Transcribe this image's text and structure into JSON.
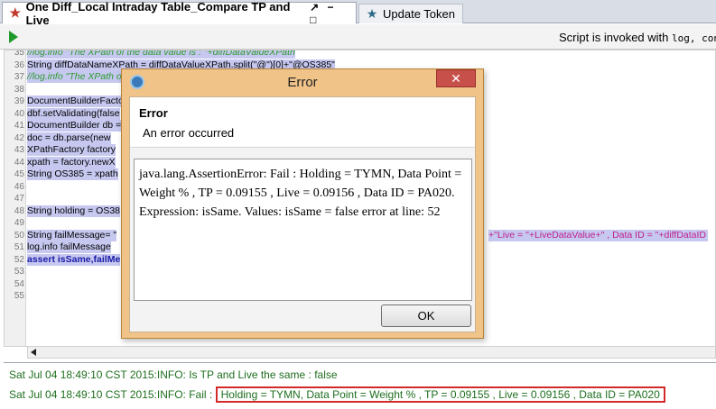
{
  "tabs": [
    {
      "label": "One Diff_Local Intraday Table_Compare TP and Live",
      "controls": "↗ − □"
    },
    {
      "label": "Update Token"
    }
  ],
  "toolbar": {
    "invoked_text": "Script is invoked with ",
    "invoked_code": "log, cont"
  },
  "code_lines": [
    {
      "num": "35",
      "text": "//log.info \"The XPath of the data value is : \"+diffDataValueXPath"
    },
    {
      "num": "36",
      "text": "String diffDataNameXPath = diffDataValueXPath.split(\"@\")[0]+\"@OS385\""
    },
    {
      "num": "37",
      "text": "//log.info \"The XPath o"
    },
    {
      "num": "38",
      "text": ""
    },
    {
      "num": "39",
      "text": "DocumentBuilderFacto"
    },
    {
      "num": "40",
      "text": "dbf.setValidating(false"
    },
    {
      "num": "41",
      "text": "DocumentBuilder db ="
    },
    {
      "num": "42",
      "text": "doc = db.parse(new"
    },
    {
      "num": "43",
      "text": "XPathFactory factory"
    },
    {
      "num": "44",
      "text": "xpath = factory.newX"
    },
    {
      "num": "45",
      "text": "String OS385 =  xpath"
    },
    {
      "num": "46",
      "text": ""
    },
    {
      "num": "47",
      "text": ""
    },
    {
      "num": "48",
      "text": "String holding = OS38"
    },
    {
      "num": "49",
      "text": ""
    },
    {
      "num": "50",
      "text": "String failMessage= \""
    },
    {
      "num": "51",
      "text": "log.info failMessage"
    },
    {
      "num": "52",
      "text": "assert isSame,failMe"
    },
    {
      "num": "53",
      "text": ""
    },
    {
      "num": "54",
      "text": ""
    },
    {
      "num": "55",
      "text": ""
    }
  ],
  "line50_tail": "+\"Live = \"+LiveDataValue+\" , Data ID = \"+diffDataID",
  "dialog": {
    "title": "Error",
    "close": "✕",
    "header": "Error",
    "subheader": "An error occurred",
    "message": "java.lang.AssertionError: Fail : Holding = TYMN, Data Point = Weight % , TP = 0.09155 , Live = 0.09156 , Data ID = PA020. Expression: isSame. Values: isSame = false error at line: 52",
    "ok": "OK"
  },
  "console": {
    "line1": "Sat Jul 04 18:49:10 CST 2015:INFO: Is TP and Live the same : false",
    "line2_prefix": "Sat Jul 04 18:49:10 CST 2015:INFO: Fail :",
    "line2_highlight": "Holding = TYMN, Data Point = Weight % , TP = 0.09155 , Live = 0.09156 , Data ID = PA020"
  },
  "colors": {
    "highlight_box": "#d22a2a",
    "console_text": "#1e6e1e",
    "dialog_frame": "#f0c389",
    "close_button": "#c7504a"
  }
}
